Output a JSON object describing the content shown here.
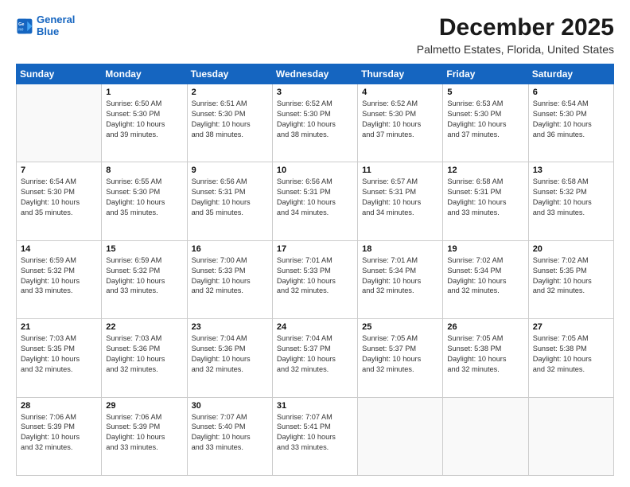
{
  "header": {
    "logo_line1": "General",
    "logo_line2": "Blue",
    "month_title": "December 2025",
    "location": "Palmetto Estates, Florida, United States"
  },
  "days_of_week": [
    "Sunday",
    "Monday",
    "Tuesday",
    "Wednesday",
    "Thursday",
    "Friday",
    "Saturday"
  ],
  "weeks": [
    [
      {
        "day": "",
        "content": ""
      },
      {
        "day": "1",
        "content": "Sunrise: 6:50 AM\nSunset: 5:30 PM\nDaylight: 10 hours\nand 39 minutes."
      },
      {
        "day": "2",
        "content": "Sunrise: 6:51 AM\nSunset: 5:30 PM\nDaylight: 10 hours\nand 38 minutes."
      },
      {
        "day": "3",
        "content": "Sunrise: 6:52 AM\nSunset: 5:30 PM\nDaylight: 10 hours\nand 38 minutes."
      },
      {
        "day": "4",
        "content": "Sunrise: 6:52 AM\nSunset: 5:30 PM\nDaylight: 10 hours\nand 37 minutes."
      },
      {
        "day": "5",
        "content": "Sunrise: 6:53 AM\nSunset: 5:30 PM\nDaylight: 10 hours\nand 37 minutes."
      },
      {
        "day": "6",
        "content": "Sunrise: 6:54 AM\nSunset: 5:30 PM\nDaylight: 10 hours\nand 36 minutes."
      }
    ],
    [
      {
        "day": "7",
        "content": "Sunrise: 6:54 AM\nSunset: 5:30 PM\nDaylight: 10 hours\nand 35 minutes."
      },
      {
        "day": "8",
        "content": "Sunrise: 6:55 AM\nSunset: 5:30 PM\nDaylight: 10 hours\nand 35 minutes."
      },
      {
        "day": "9",
        "content": "Sunrise: 6:56 AM\nSunset: 5:31 PM\nDaylight: 10 hours\nand 35 minutes."
      },
      {
        "day": "10",
        "content": "Sunrise: 6:56 AM\nSunset: 5:31 PM\nDaylight: 10 hours\nand 34 minutes."
      },
      {
        "day": "11",
        "content": "Sunrise: 6:57 AM\nSunset: 5:31 PM\nDaylight: 10 hours\nand 34 minutes."
      },
      {
        "day": "12",
        "content": "Sunrise: 6:58 AM\nSunset: 5:31 PM\nDaylight: 10 hours\nand 33 minutes."
      },
      {
        "day": "13",
        "content": "Sunrise: 6:58 AM\nSunset: 5:32 PM\nDaylight: 10 hours\nand 33 minutes."
      }
    ],
    [
      {
        "day": "14",
        "content": "Sunrise: 6:59 AM\nSunset: 5:32 PM\nDaylight: 10 hours\nand 33 minutes."
      },
      {
        "day": "15",
        "content": "Sunrise: 6:59 AM\nSunset: 5:32 PM\nDaylight: 10 hours\nand 33 minutes."
      },
      {
        "day": "16",
        "content": "Sunrise: 7:00 AM\nSunset: 5:33 PM\nDaylight: 10 hours\nand 32 minutes."
      },
      {
        "day": "17",
        "content": "Sunrise: 7:01 AM\nSunset: 5:33 PM\nDaylight: 10 hours\nand 32 minutes."
      },
      {
        "day": "18",
        "content": "Sunrise: 7:01 AM\nSunset: 5:34 PM\nDaylight: 10 hours\nand 32 minutes."
      },
      {
        "day": "19",
        "content": "Sunrise: 7:02 AM\nSunset: 5:34 PM\nDaylight: 10 hours\nand 32 minutes."
      },
      {
        "day": "20",
        "content": "Sunrise: 7:02 AM\nSunset: 5:35 PM\nDaylight: 10 hours\nand 32 minutes."
      }
    ],
    [
      {
        "day": "21",
        "content": "Sunrise: 7:03 AM\nSunset: 5:35 PM\nDaylight: 10 hours\nand 32 minutes."
      },
      {
        "day": "22",
        "content": "Sunrise: 7:03 AM\nSunset: 5:36 PM\nDaylight: 10 hours\nand 32 minutes."
      },
      {
        "day": "23",
        "content": "Sunrise: 7:04 AM\nSunset: 5:36 PM\nDaylight: 10 hours\nand 32 minutes."
      },
      {
        "day": "24",
        "content": "Sunrise: 7:04 AM\nSunset: 5:37 PM\nDaylight: 10 hours\nand 32 minutes."
      },
      {
        "day": "25",
        "content": "Sunrise: 7:05 AM\nSunset: 5:37 PM\nDaylight: 10 hours\nand 32 minutes."
      },
      {
        "day": "26",
        "content": "Sunrise: 7:05 AM\nSunset: 5:38 PM\nDaylight: 10 hours\nand 32 minutes."
      },
      {
        "day": "27",
        "content": "Sunrise: 7:05 AM\nSunset: 5:38 PM\nDaylight: 10 hours\nand 32 minutes."
      }
    ],
    [
      {
        "day": "28",
        "content": "Sunrise: 7:06 AM\nSunset: 5:39 PM\nDaylight: 10 hours\nand 32 minutes."
      },
      {
        "day": "29",
        "content": "Sunrise: 7:06 AM\nSunset: 5:39 PM\nDaylight: 10 hours\nand 33 minutes."
      },
      {
        "day": "30",
        "content": "Sunrise: 7:07 AM\nSunset: 5:40 PM\nDaylight: 10 hours\nand 33 minutes."
      },
      {
        "day": "31",
        "content": "Sunrise: 7:07 AM\nSunset: 5:41 PM\nDaylight: 10 hours\nand 33 minutes."
      },
      {
        "day": "",
        "content": ""
      },
      {
        "day": "",
        "content": ""
      },
      {
        "day": "",
        "content": ""
      }
    ]
  ]
}
